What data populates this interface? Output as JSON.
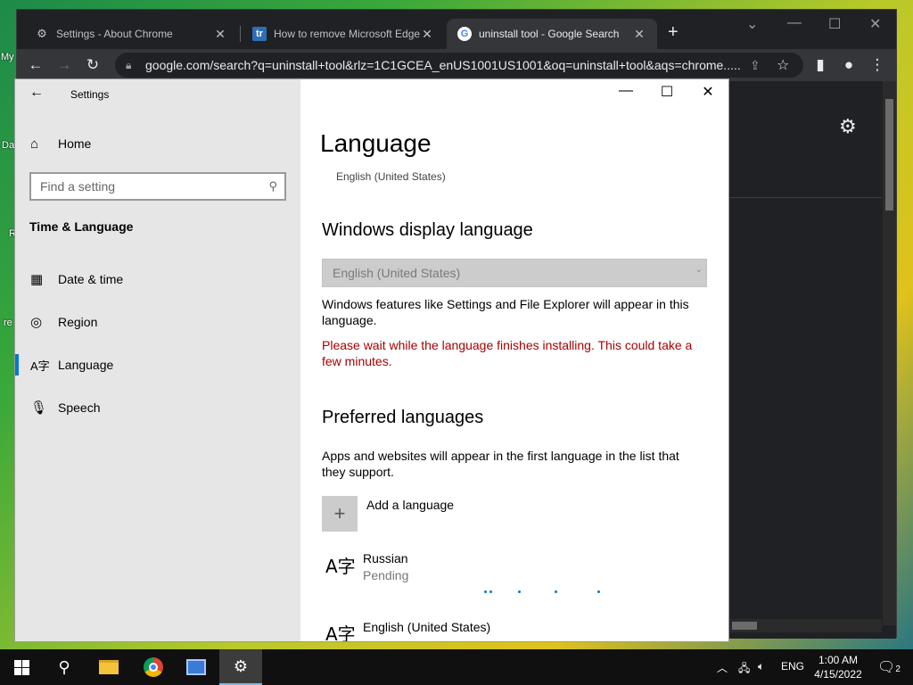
{
  "desktop": {
    "labels": [
      "My",
      "Da",
      "R",
      "re"
    ]
  },
  "chrome": {
    "tabs": [
      {
        "title": "Settings - About Chrome",
        "icon": "gear-icon"
      },
      {
        "title": "How to remove Microsoft Edge f",
        "icon": "techrepublic-icon",
        "icon_text": "tr"
      },
      {
        "title": "uninstall tool - Google Search",
        "icon": "google-icon",
        "icon_text": "G"
      }
    ],
    "active_tab": 2,
    "new_tab": "+",
    "url": "google.com/search?q=uninstall+tool&rlz=1C1GCEA_enUS1001US1001&oq=uninstall+tool&aqs=chrome....."
  },
  "settings": {
    "app_title": "Settings",
    "home": "Home",
    "search_placeholder": "Find a setting",
    "section": "Time & Language",
    "nav": [
      {
        "label": "Date & time",
        "icon": "calendar-clock-icon"
      },
      {
        "label": "Region",
        "icon": "globe-icon"
      },
      {
        "label": "Language",
        "icon": "language-icon"
      },
      {
        "label": "Speech",
        "icon": "microphone-icon"
      }
    ],
    "selected_nav": "Language",
    "page_title": "Language",
    "current_language_sub": "English (United States)",
    "display_language_heading": "Windows display language",
    "display_language_value": "English (United States)",
    "display_language_desc": "Windows features like Settings and File Explorer will appear in this language.",
    "warning": "Please wait while the language finishes installing. This could take a few minutes.",
    "preferred_heading": "Preferred languages",
    "preferred_desc": "Apps and websites will appear in the first language in the list that they support.",
    "add_language": "Add a language",
    "languages": [
      {
        "name": "Russian",
        "status": "Pending"
      },
      {
        "name": "English (United States)",
        "status": ""
      }
    ]
  },
  "taskbar": {
    "input_lang": "ENG",
    "time": "1:00 AM",
    "date": "4/15/2022",
    "notifications": "2"
  },
  "colors": {
    "accent": "#0078d7",
    "warning": "#a80000",
    "chrome_dark": "#202124"
  }
}
